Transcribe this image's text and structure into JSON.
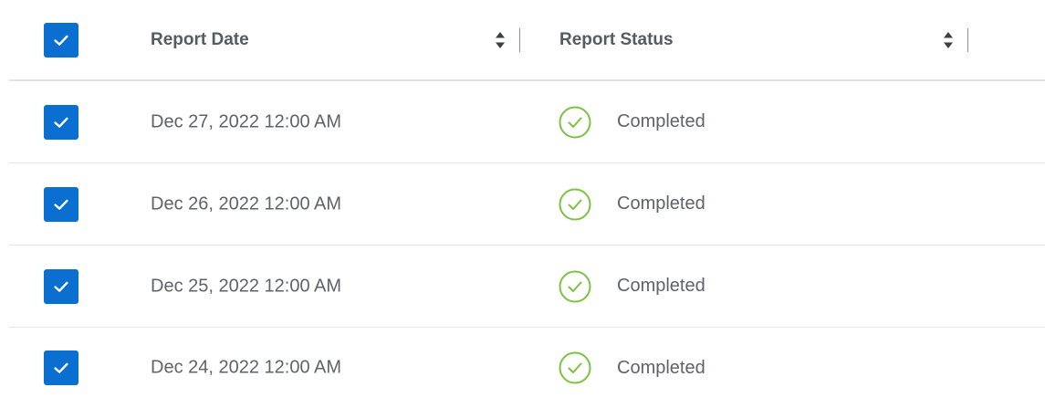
{
  "header": {
    "select_all_checked": true,
    "report_date_label": "Report Date",
    "report_status_label": "Report Status"
  },
  "rows": [
    {
      "checked": true,
      "date": "Dec 27, 2022 12:00 AM",
      "status": "Completed",
      "status_icon": "check-circle-icon"
    },
    {
      "checked": true,
      "date": "Dec 26, 2022 12:00 AM",
      "status": "Completed",
      "status_icon": "check-circle-icon"
    },
    {
      "checked": true,
      "date": "Dec 25, 2022 12:00 AM",
      "status": "Completed",
      "status_icon": "check-circle-icon"
    },
    {
      "checked": true,
      "date": "Dec 24, 2022 12:00 AM",
      "status": "Completed",
      "status_icon": "check-circle-icon"
    }
  ],
  "colors": {
    "checkbox": "#0b6fd1",
    "status_success": "#7cc242",
    "text": "#5f6368"
  }
}
